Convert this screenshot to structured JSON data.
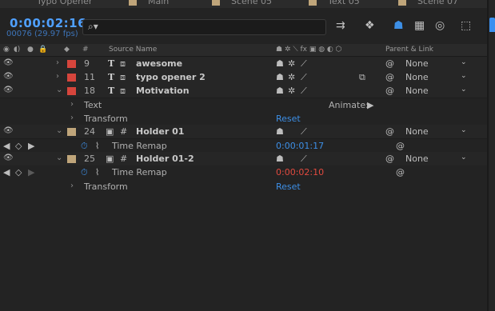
{
  "tabs": [
    {
      "label": "Typo Opener"
    },
    {
      "label": "Main"
    },
    {
      "label": "Scene 05"
    },
    {
      "label": "Text 05"
    },
    {
      "label": "Scene 07"
    }
  ],
  "header": {
    "timecode": "0:00:02:16",
    "frames": "00076 (29.97 fps)",
    "search_placeholder": ""
  },
  "columns": {
    "hash": "#",
    "source_name": "Source Name",
    "parent_link": "Parent & Link"
  },
  "layers": [
    {
      "num": "9",
      "name": "awesome",
      "parent": "None"
    },
    {
      "num": "11",
      "name": "typo opener 2",
      "parent": "None"
    },
    {
      "num": "18",
      "name": "Motivation",
      "parent": "None"
    }
  ],
  "motivation_props": {
    "text": "Text",
    "animate": "Animate:",
    "transform": "Transform",
    "reset": "Reset"
  },
  "holder1": {
    "num": "24",
    "name": "Holder 01",
    "parent": "None",
    "time_remap": "Time Remap",
    "time_remap_value": "0:00:01:17"
  },
  "holder2": {
    "num": "25",
    "name": "Holder 01-2",
    "parent": "None",
    "time_remap": "Time Remap",
    "time_remap_value": "0:00:02:10",
    "transform": "Transform",
    "reset": "Reset"
  },
  "colors": {
    "accent": "#3d8fe6",
    "label_red": "#d6453c",
    "label_tan": "#bfa57a",
    "time_red": "#e24a3f"
  }
}
